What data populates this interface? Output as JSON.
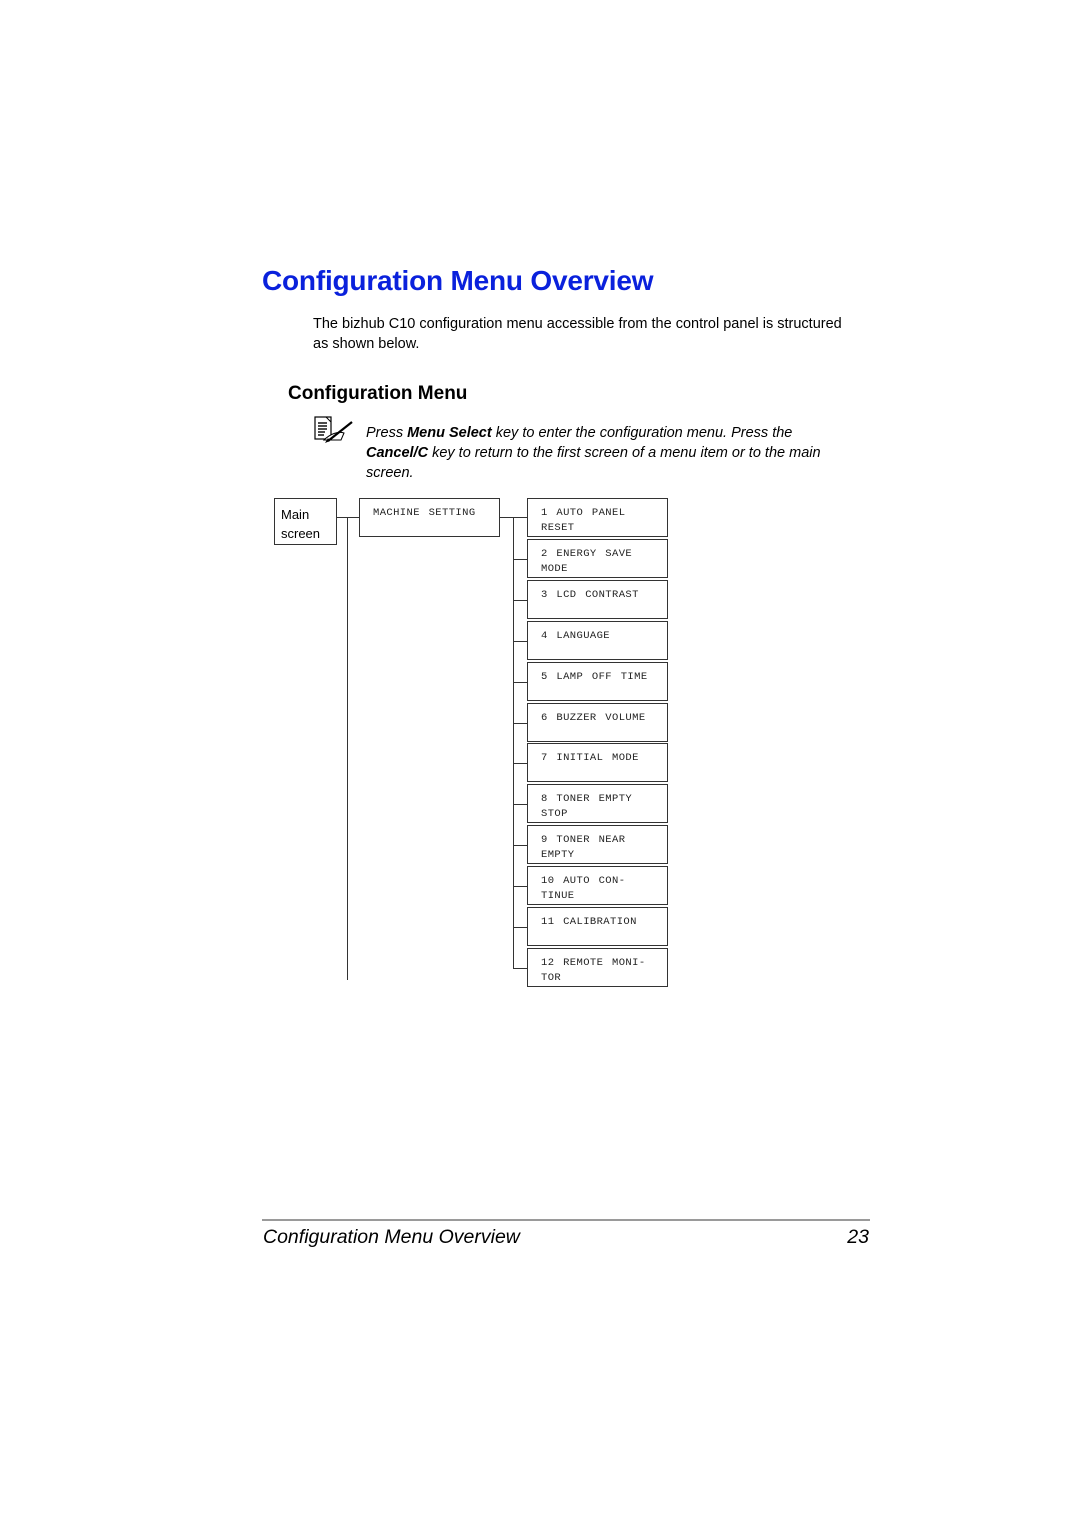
{
  "page": {
    "title": "Configuration Menu Overview",
    "intro": "The bizhub C10 configuration menu accessible from the control panel is structured as shown below.",
    "section_title": "Configuration Menu",
    "note": {
      "icon": "note-pencil-icon",
      "parts": [
        {
          "text": "Press ",
          "bold": false
        },
        {
          "text": "Menu Select",
          "bold": true
        },
        {
          "text": " key to enter the configuration menu. Press the ",
          "bold": false
        },
        {
          "text": "Cancel/C",
          "bold": true
        },
        {
          "text": " key to return to the first screen of a menu item or to the main screen.",
          "bold": false
        }
      ]
    },
    "accent_color": "#0a21dc"
  },
  "diagram": {
    "root": "Main screen",
    "level1": "MACHINE SETTING",
    "items": [
      "1 AUTO PANEL\nRESET",
      "2 ENERGY SAVE\nMODE",
      "3 LCD CONTRAST",
      "4 LANGUAGE",
      "5 LAMP OFF TIME",
      "6 BUZZER VOLUME",
      "7 INITIAL MODE",
      "8 TONER EMPTY\nSTOP",
      "9 TONER NEAR\nEMPTY",
      "10 AUTO CON-\nTINUE",
      "11 CALIBRATION",
      "12 REMOTE MONI-\nTOR"
    ]
  },
  "footer": {
    "title": "Configuration Menu Overview",
    "page_number": "23"
  }
}
